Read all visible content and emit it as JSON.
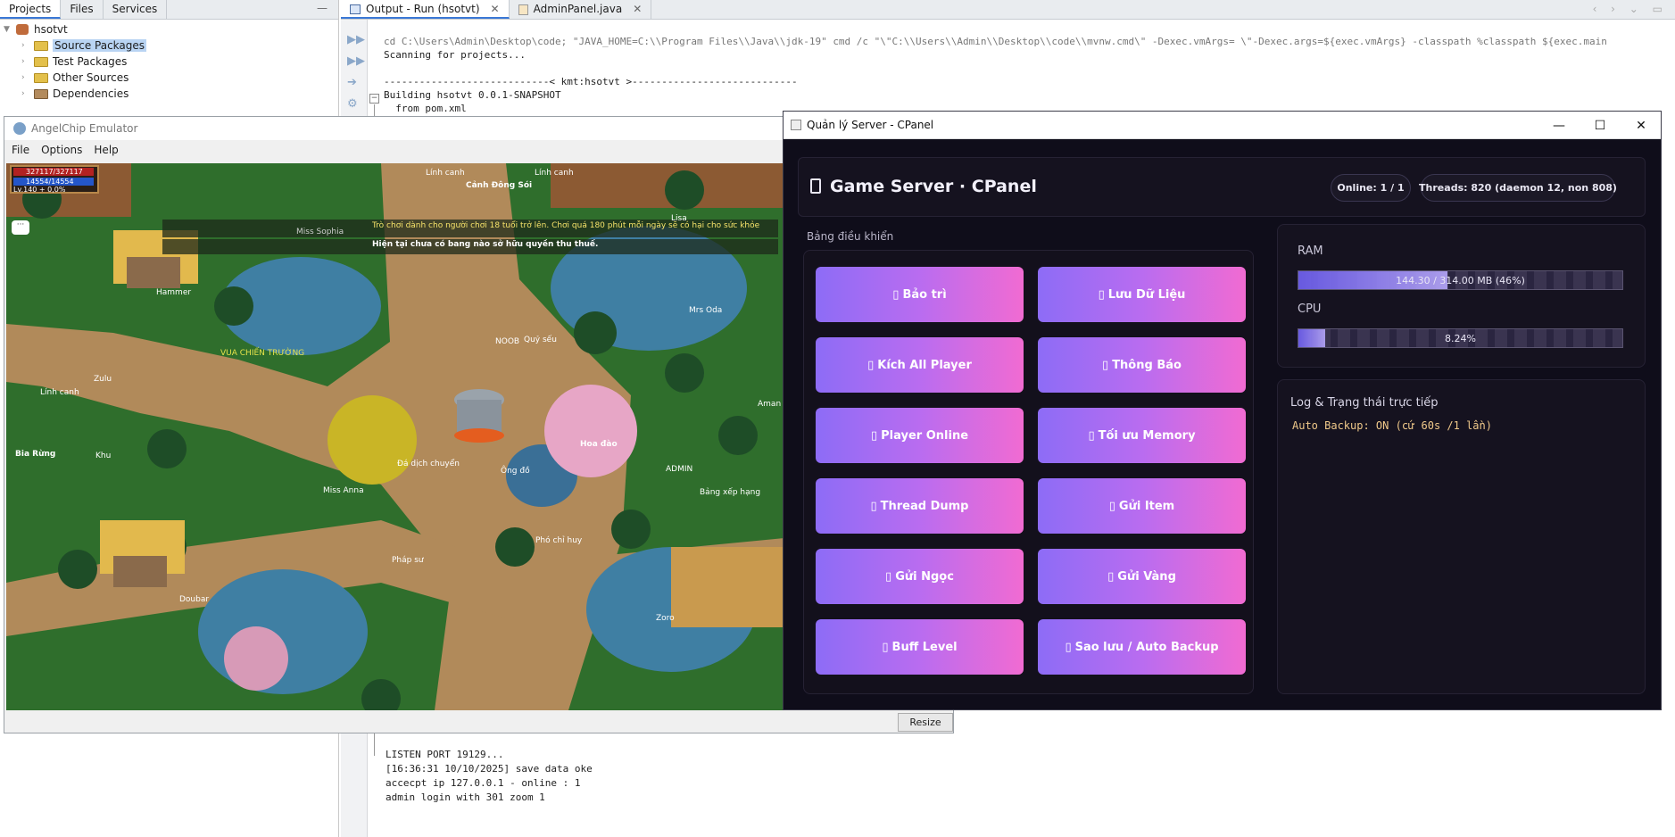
{
  "projects": {
    "tabs": [
      "Projects",
      "Files",
      "Services"
    ],
    "root": "hsotvt",
    "items": [
      "Source Packages",
      "Test Packages",
      "Other Sources",
      "Dependencies"
    ]
  },
  "output": {
    "tabs": [
      "Output - Run (hsotvt)",
      "AdminPanel.java"
    ],
    "lines_top": [
      "cd C:\\Users\\Admin\\Desktop\\code; \"JAVA_HOME=C:\\\\Program Files\\\\Java\\\\jdk-19\" cmd /c \"\\\"C:\\\\Users\\\\Admin\\\\Desktop\\\\code\\\\mvnw.cmd\\\" -Dexec.vmArgs= \\\"-Dexec.args=${exec.vmArgs} -classpath %classpath ${exec.main",
      "Scanning for projects...",
      "",
      "----------------------------< kmt:hsotvt >----------------------------",
      "Building hsotvt 0.0.1-SNAPSHOT",
      "  from pom.xml"
    ],
    "lines_bottom": [
      "LISTEN PORT 19129...",
      "[16:36:31 10/10/2025] save data oke",
      "accecpt ip 127.0.0.1 - online : 1",
      "admin login with 301 zoom 1"
    ]
  },
  "emulator": {
    "title": "AngelChip Emulator",
    "menu": [
      "File",
      "Options",
      "Help"
    ],
    "resize_label": "Resize",
    "hud": {
      "hp": "327117/327117",
      "mp": "14554/14554",
      "level": "Lv.140 + 0,0%"
    },
    "banner1": "Trò chơi dành cho người chơi 18 tuổi trở lên. Chơi quá 180 phút mỗi ngày sẽ có hại cho sức khỏe",
    "banner2": "Hiện tại chưa có bang nào sở hữu quyền thu thuế.",
    "map_labels": [
      "Lính canh",
      "Cảnh Đông Sói",
      "Lính canh",
      "Lisa",
      "Miss Sophia",
      "Hammer",
      "Mrs Oda",
      "VUA CHIẾN TRƯỜNG",
      "Lính canh",
      "Zulu",
      "NOOB",
      "Quỷ sếu",
      "Bia Rừng",
      "Khu",
      "Đá dịch chuyển",
      "Ông đồ",
      "Hoa đào",
      "ADMIN",
      "Miss Anna",
      "Bảng xếp hạng",
      "Pháp sư",
      "Phó chỉ huy",
      "Doubar",
      "Zoro",
      "Aman"
    ]
  },
  "cpanel": {
    "window_title": "Quản lý Server - CPanel",
    "header_title": "Game Server · CPanel",
    "online": "Online: 1 / 1",
    "threads": "Threads: 820 (daemon 12, non 808)",
    "dashboard_label": "Bảng điều khiển",
    "buttons": [
      "Bảo trì",
      "Lưu Dữ Liệu",
      "Kích All Player",
      "Thông Báo",
      "Player Online",
      "Tối ưu Memory",
      "Thread Dump",
      "Gửi Item",
      "Gửi Ngọc",
      "Gửi Vàng",
      "Buff Level",
      "Sao lưu / Auto Backup"
    ],
    "ram_label": "RAM",
    "ram_text": "144.30 / 314.00 MB (46%)",
    "ram_fraction": 0.46,
    "cpu_label": "CPU",
    "cpu_text": "8.24%",
    "cpu_fraction": 0.0824,
    "log_title": "Log & Trạng thái trực tiếp",
    "log_line": "Auto Backup: ON (cứ 60s /1 lần)",
    "accent": "#8d6cf6",
    "accent2": "#f16bd2"
  }
}
